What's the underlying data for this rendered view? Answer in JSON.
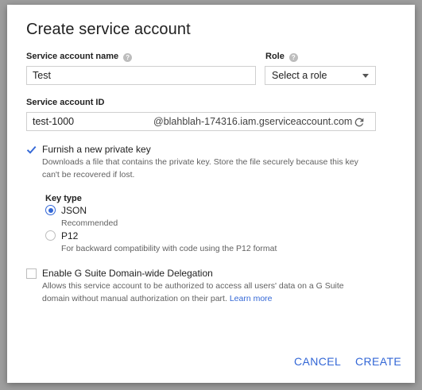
{
  "dialog": {
    "title": "Create service account",
    "name_label": "Service account name",
    "name_value": "Test",
    "role_label": "Role",
    "role_value": "Select a role",
    "id_label": "Service account ID",
    "id_value": "test-1000",
    "id_suffix": "@blahblah-174316.iam.gserviceaccount.com",
    "private_key": {
      "checked": true,
      "label": "Furnish a new private key",
      "desc_line1": "Downloads a file that contains the private key. Store the file securely because this key",
      "desc_line2": "can't be recovered if lost.",
      "key_type_label": "Key type",
      "options": [
        {
          "label": "JSON",
          "hint": "Recommended",
          "selected": true
        },
        {
          "label": "P12",
          "hint": "For backward compatibility with code using the P12 format",
          "selected": false
        }
      ]
    },
    "delegation": {
      "checked": false,
      "label": "Enable G Suite Domain-wide Delegation",
      "desc_line1": "Allows this service account to be authorized to access all users' data on a G Suite",
      "desc_line2": "domain without manual authorization on their part.",
      "link": "Learn more"
    },
    "buttons": {
      "cancel": "CANCEL",
      "create": "CREATE"
    },
    "accent_color": "#3367d6"
  }
}
